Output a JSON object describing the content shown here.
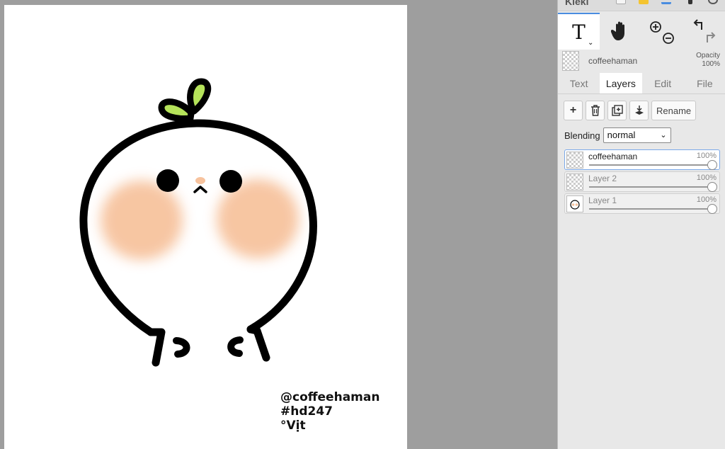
{
  "canvas": {
    "watermark_lines": [
      "@coffeehaman",
      "#hd247",
      "°Vịt"
    ]
  },
  "header": {
    "app_name": "Kleki"
  },
  "toolbar": {
    "tools": [
      {
        "name": "text",
        "glyph": "T",
        "active": true
      },
      {
        "name": "hand",
        "glyph": "hand-icon"
      },
      {
        "name": "zoom",
        "glyph": "zoom-in-out-icon"
      },
      {
        "name": "undo-redo",
        "glyph": "undo-redo-icon"
      }
    ]
  },
  "current_layer": {
    "name": "coffeehaman",
    "opacity_label": "Opacity",
    "opacity_value": "100%"
  },
  "tabs": [
    {
      "label": "Text"
    },
    {
      "label": "Layers",
      "active": true
    },
    {
      "label": "Edit"
    },
    {
      "label": "File"
    }
  ],
  "layer_actions": {
    "add": "+",
    "rename_label": "Rename"
  },
  "blending": {
    "label": "Blending",
    "value": "normal"
  },
  "layers": [
    {
      "name": "coffeehaman",
      "opacity": "100%",
      "opacity_fraction": 1.0,
      "selected": true
    },
    {
      "name": "Layer 2",
      "opacity": "100%",
      "opacity_fraction": 1.0
    },
    {
      "name": "Layer 1",
      "opacity": "100%",
      "opacity_fraction": 1.0
    }
  ],
  "colors": {
    "accent": "#4a8de0",
    "panel_bg": "#e8e8e8",
    "workspace_bg": "#9e9e9e",
    "blush": "#f7c39e",
    "leaf": "#b5e35a"
  }
}
